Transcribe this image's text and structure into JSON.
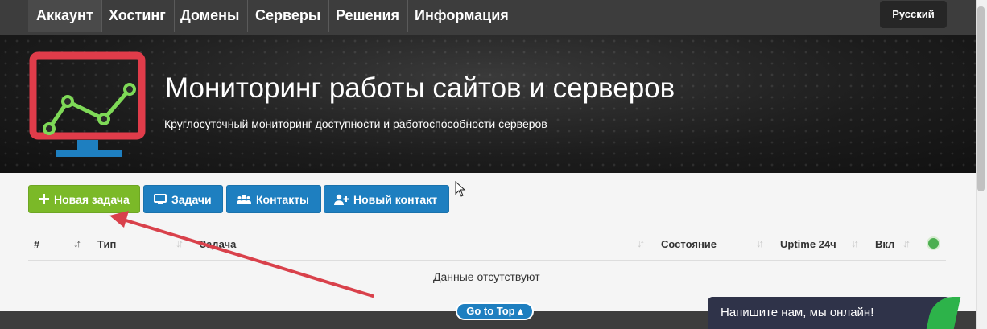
{
  "nav": {
    "items": [
      {
        "label": "Аккаунт"
      },
      {
        "label": "Хостинг"
      },
      {
        "label": "Домены"
      },
      {
        "label": "Серверы"
      },
      {
        "label": "Решения"
      },
      {
        "label": "Информация"
      }
    ],
    "language": "Русский"
  },
  "hero": {
    "title": "Мониторинг работы сайтов и серверов",
    "subtitle": "Круглосуточный мониторинг доступности и работоспособности серверов"
  },
  "toolbar": {
    "new_task": "Новая задача",
    "tasks": "Задачи",
    "contacts": "Контакты",
    "new_contact": "Новый контакт"
  },
  "table": {
    "columns": [
      "#",
      "Тип",
      "Задача",
      "Состояние",
      "Uptime 24ч",
      "Вкл"
    ],
    "empty_text": "Данные отсутствуют"
  },
  "go_top": "Go to Top ▴",
  "chat": {
    "label": "Напишите нам, мы онлайн!"
  },
  "colors": {
    "nav_bg": "#3d3d3d",
    "green": "#7bb928",
    "blue": "#1e7fc0",
    "logo_red": "#e03c4a",
    "logo_green": "#7ed957",
    "arrow_red": "#d9414b"
  }
}
